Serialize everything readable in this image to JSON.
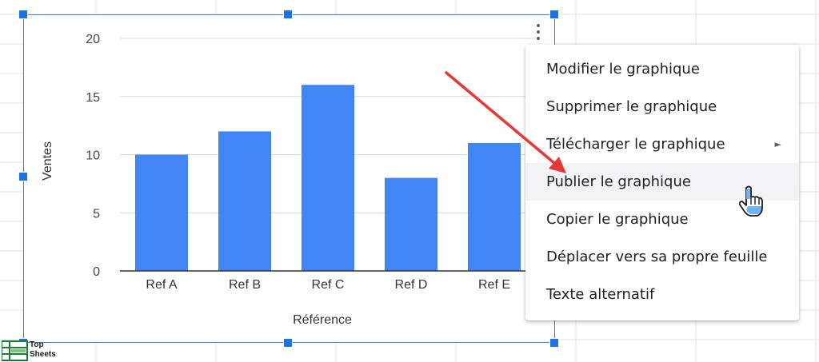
{
  "chart": {
    "colors": {
      "bar": "#4285f4",
      "gridline": "#d9d9d9",
      "axis_line": "#333333",
      "border": "#4a7ebb",
      "handle": "#1a73e8"
    }
  },
  "chart_data": {
    "type": "bar",
    "categories": [
      "Ref A",
      "Ref B",
      "Ref C",
      "Ref D",
      "Ref E"
    ],
    "values": [
      10,
      12,
      16,
      8,
      11
    ],
    "xlabel": "Référence",
    "ylabel": "Ventes",
    "ylim": [
      0,
      20
    ],
    "yticks": [
      0,
      5,
      10,
      15,
      20
    ],
    "grid": true,
    "legend": "none"
  },
  "context_menu": {
    "items": [
      {
        "label": "Modifier le graphique",
        "submenu": false,
        "highlighted": false
      },
      {
        "label": "Supprimer le graphique",
        "submenu": false,
        "highlighted": false
      },
      {
        "label": "Télécharger le graphique",
        "submenu": true,
        "highlighted": false
      },
      {
        "label": "Publier le graphique",
        "submenu": false,
        "highlighted": true
      },
      {
        "label": "Copier le graphique",
        "submenu": false,
        "highlighted": false
      },
      {
        "label": "Déplacer vers sa propre feuille",
        "submenu": false,
        "highlighted": false
      },
      {
        "label": "Texte alternatif",
        "submenu": false,
        "highlighted": false
      }
    ],
    "submenu_glyph": "►"
  },
  "annotation": {
    "color": "#e53935"
  },
  "watermark": {
    "line1": "Top",
    "line2": "Sheets"
  },
  "icons": {
    "menu": "more-vert-icon",
    "cursor": "hand-pointer-icon",
    "logo": "top-sheets-logo-icon"
  }
}
